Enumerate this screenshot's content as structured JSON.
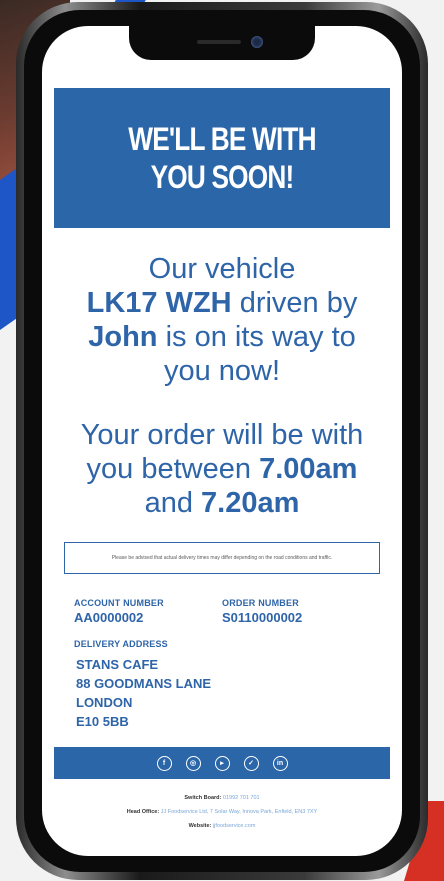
{
  "banner": {
    "line1": "WE'LL BE WITH",
    "line2": "YOU SOON!"
  },
  "message": {
    "pre": "Our vehicle",
    "registration": "LK17 WZH",
    "driven_by": "driven by",
    "driver": "John",
    "on_way": "is on its way to",
    "now": "you now!"
  },
  "eta": {
    "line1": "Your order will be with",
    "between": "you between",
    "start": "7.00am",
    "and": "and",
    "end": "7.20am"
  },
  "notice": "Please be advised that actual delivery times may differ depending on the road conditions and traffic.",
  "account": {
    "label": "ACCOUNT NUMBER",
    "value": "AA0000002"
  },
  "order": {
    "label": "ORDER NUMBER",
    "value": "S0110000002"
  },
  "delivery": {
    "label": "DELIVERY ADDRESS",
    "lines": [
      "STANS CAFE",
      "88 GOODMANS LANE",
      "LONDON",
      "E10 5BB"
    ]
  },
  "social": {
    "icons": [
      "facebook-icon",
      "instagram-icon",
      "youtube-icon",
      "twitter-icon",
      "linkedin-icon"
    ],
    "glyphs": [
      "f",
      "◎",
      "▸",
      "✓",
      "in"
    ]
  },
  "footer": {
    "switchboard_label": "Switch Board:",
    "switchboard_value": "01992 701 701",
    "head_office_label": "Head Office:",
    "head_office_value": "JJ Foodservice Ltd, 7 Solar Way, Innova Park, Enfield, EN3 7XY",
    "website_label": "Website:",
    "website_value": "jjfoodservice.com"
  },
  "colors": {
    "brand_blue": "#2b66a8",
    "text_blue": "#2e64a8"
  }
}
